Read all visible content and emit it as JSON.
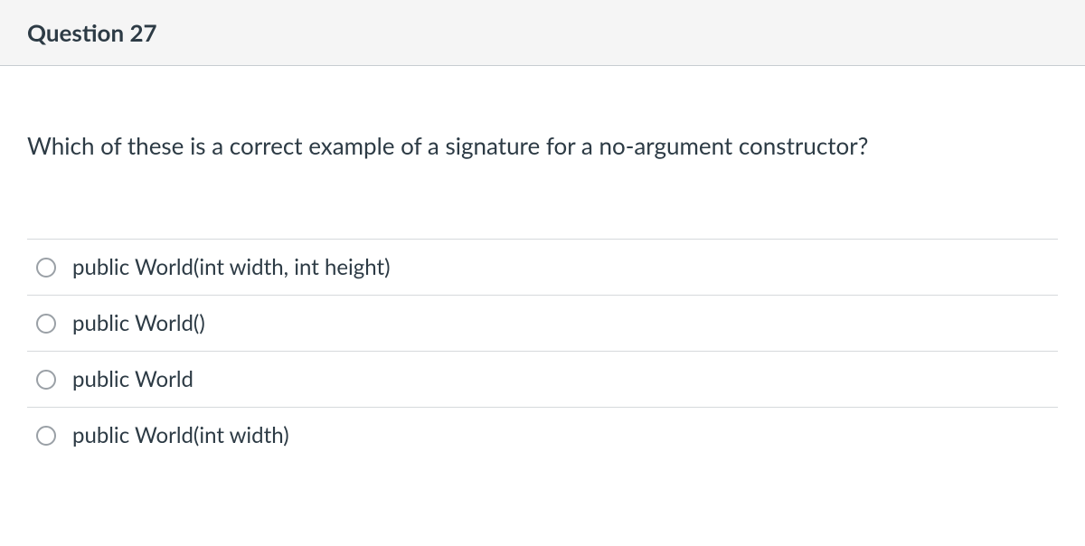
{
  "header": {
    "title": "Question 27"
  },
  "question": {
    "text": "Which of these is a correct example of a signature for a no-argument constructor?"
  },
  "options": [
    {
      "label": "public World(int width, int height)"
    },
    {
      "label": "public World()"
    },
    {
      "label": "public World"
    },
    {
      "label": "public World(int width)"
    }
  ]
}
